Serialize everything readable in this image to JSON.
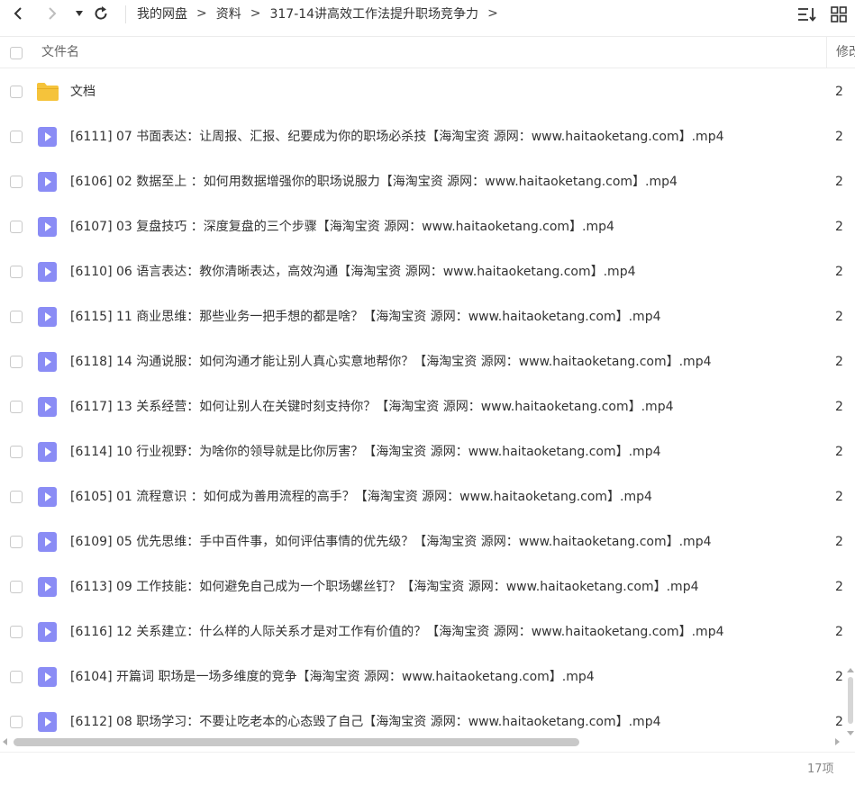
{
  "nav": {
    "back_icon": "chevron-left-icon",
    "forward_icon": "chevron-right-icon",
    "history_icon": "caret-down-icon",
    "refresh_icon": "refresh-icon"
  },
  "breadcrumb": {
    "items": [
      "我的网盘",
      "资料",
      "317-14讲高效工作法提升职场竞争力"
    ],
    "separator": ">"
  },
  "toolbar": {
    "sort_icon": "sort-icon",
    "view_icon": "grid-view-icon"
  },
  "header": {
    "name_col": "文件名",
    "modified_col": "修改"
  },
  "files": [
    {
      "name": "文档",
      "type": "folder",
      "date": "2"
    },
    {
      "name": "[6111] 07  书面表达：让周报、汇报、纪要成为你的职场必杀技【海淘宝资 源网：www.haitaoketang.com】.mp4",
      "type": "video",
      "date": "2"
    },
    {
      "name": "[6106] 02  数据至上 ：如何用数据增强你的职场说服力【海淘宝资 源网：www.haitaoketang.com】.mp4",
      "type": "video",
      "date": "2"
    },
    {
      "name": "[6107] 03  复盘技巧 ：深度复盘的三个步骤【海淘宝资 源网：www.haitaoketang.com】.mp4",
      "type": "video",
      "date": "2"
    },
    {
      "name": "[6110] 06  语言表达：教你清晰表达，高效沟通【海淘宝资 源网：www.haitaoketang.com】.mp4",
      "type": "video",
      "date": "2"
    },
    {
      "name": "[6115] 11  商业思维：那些业务一把手想的都是啥？【海淘宝资 源网：www.haitaoketang.com】.mp4",
      "type": "video",
      "date": "2"
    },
    {
      "name": "[6118] 14  沟通说服：如何沟通才能让别人真心实意地帮你？【海淘宝资 源网：www.haitaoketang.com】.mp4",
      "type": "video",
      "date": "2"
    },
    {
      "name": "[6117] 13  关系经营：如何让别人在关键时刻支持你？【海淘宝资 源网：www.haitaoketang.com】.mp4",
      "type": "video",
      "date": "2"
    },
    {
      "name": "[6114] 10  行业视野：为啥你的领导就是比你厉害？【海淘宝资 源网：www.haitaoketang.com】.mp4",
      "type": "video",
      "date": "2"
    },
    {
      "name": "[6105] 01  流程意识 ：如何成为善用流程的高手？【海淘宝资 源网：www.haitaoketang.com】.mp4",
      "type": "video",
      "date": "2"
    },
    {
      "name": "[6109] 05  优先思维：手中百件事，如何评估事情的优先级？【海淘宝资 源网：www.haitaoketang.com】.mp4",
      "type": "video",
      "date": "2"
    },
    {
      "name": "[6113] 09  工作技能：如何避免自己成为一个职场螺丝钉？【海淘宝资 源网：www.haitaoketang.com】.mp4",
      "type": "video",
      "date": "2"
    },
    {
      "name": "[6116] 12  关系建立：什么样的人际关系才是对工作有价值的？【海淘宝资 源网：www.haitaoketang.com】.mp4",
      "type": "video",
      "date": "2"
    },
    {
      "name": "[6104] 开篇词  职场是一场多维度的竞争【海淘宝资 源网：www.haitaoketang.com】.mp4",
      "type": "video",
      "date": "2"
    },
    {
      "name": "[6112] 08  职场学习：不要让吃老本的心态毁了自己【海淘宝资 源网：www.haitaoketang.com】.mp4",
      "type": "video",
      "date": "2"
    }
  ],
  "footer": {
    "count": "17项"
  },
  "colors": {
    "folder": "#f5c33b",
    "video": "#8a8cf5",
    "border": "#ececec"
  }
}
